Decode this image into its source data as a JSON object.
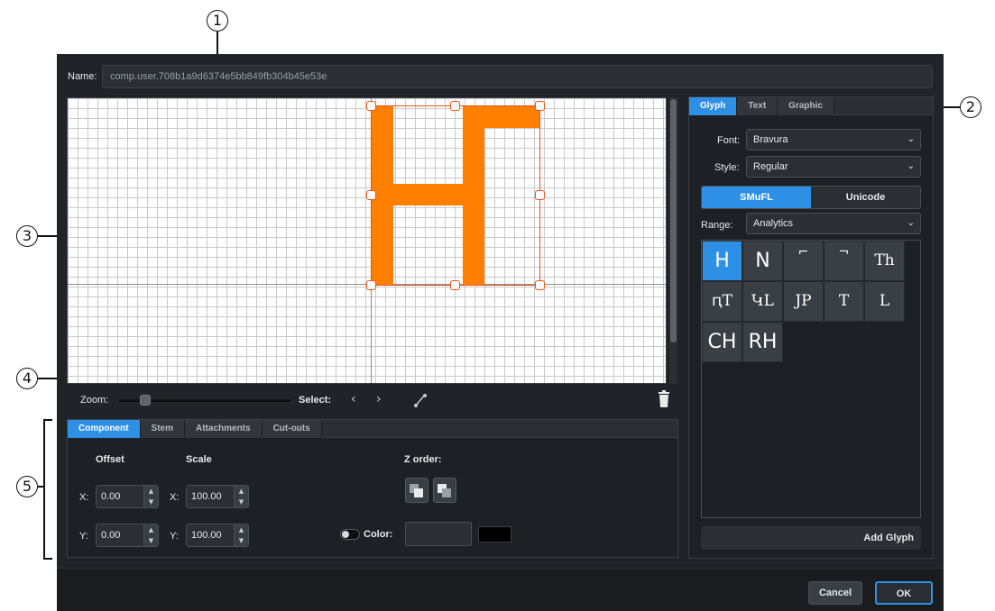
{
  "callouts": [
    "1",
    "2",
    "3",
    "4",
    "5"
  ],
  "dialog": {
    "name_label": "Name:",
    "name_value": "comp.user.708b1a9d6374e5bb849fb304b45e53e"
  },
  "editor": {
    "zoom_label": "Zoom:",
    "zoom_level": 0.15,
    "select_label": "Select:",
    "prev_icon": "chevron-left-icon",
    "next_icon": "chevron-right-icon",
    "flip_icon": "diagonal-arrow-icon",
    "delete_icon": "trash-icon",
    "glyph_color": "#ff7f00",
    "handle_color": "#e8541a"
  },
  "properties": {
    "tabs": [
      "Component",
      "Stem",
      "Attachments",
      "Cut-outs"
    ],
    "active_tab": "Component",
    "offset_label": "Offset",
    "scale_label": "Scale",
    "x_label": "X:",
    "y_label": "Y:",
    "offset_x": "0.00",
    "offset_y": "0.00",
    "scale_x": "100.00",
    "scale_y": "100.00",
    "z_order_label": "Z order:",
    "color_label": "Color:",
    "color_value": "#000000"
  },
  "glyph_panel": {
    "tabs": [
      "Glyph",
      "Text",
      "Graphic"
    ],
    "active_tab": "Glyph",
    "font_label": "Font:",
    "font_value": "Bravura",
    "style_label": "Style:",
    "style_value": "Regular",
    "seg_smufl": "SMuFL",
    "seg_unicode": "Unicode",
    "range_label": "Range:",
    "range_value": "Analytics",
    "glyphs": [
      "H",
      "N",
      "⌐",
      "¬",
      "Th",
      "ԥT",
      "ԿL",
      "JP",
      "T",
      "L",
      "CH",
      "RH"
    ],
    "add_glyph": "Add Glyph",
    "accent": "#2e90e5"
  },
  "footer": {
    "cancel": "Cancel",
    "ok": "OK"
  }
}
